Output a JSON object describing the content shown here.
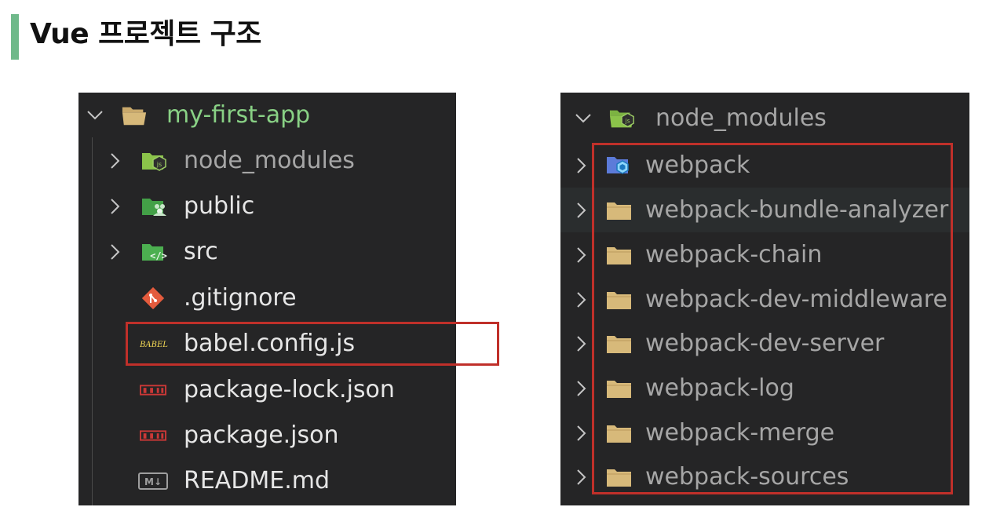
{
  "title": "Vue 프로젝트 구조",
  "colors": {
    "accent_bar": "#6fb98a",
    "panel_bg": "#252526",
    "highlight_border": "#c0302a"
  },
  "left_panel": {
    "root": {
      "label": "my-first-app",
      "icon": "folder-open-icon",
      "expanded": true
    },
    "items": [
      {
        "label": "node_modules",
        "icon": "nodejs-folder-icon",
        "type": "folder"
      },
      {
        "label": "public",
        "icon": "public-folder-icon",
        "type": "folder"
      },
      {
        "label": "src",
        "icon": "src-folder-icon",
        "type": "folder"
      },
      {
        "label": ".gitignore",
        "icon": "git-icon",
        "type": "file"
      },
      {
        "label": "babel.config.js",
        "icon": "babel-icon",
        "type": "file",
        "highlighted": true
      },
      {
        "label": "package-lock.json",
        "icon": "npm-icon",
        "type": "file"
      },
      {
        "label": "package.json",
        "icon": "npm-icon",
        "type": "file"
      },
      {
        "label": "README.md",
        "icon": "markdown-icon",
        "type": "file"
      }
    ]
  },
  "right_panel": {
    "root": {
      "label": "node_modules",
      "icon": "nodejs-folder-icon",
      "expanded": true
    },
    "items": [
      {
        "label": "webpack",
        "icon": "webpack-icon"
      },
      {
        "label": "webpack-bundle-analyzer",
        "icon": "folder-icon"
      },
      {
        "label": "webpack-chain",
        "icon": "folder-icon"
      },
      {
        "label": "webpack-dev-middleware",
        "icon": "folder-icon"
      },
      {
        "label": "webpack-dev-server",
        "icon": "folder-icon"
      },
      {
        "label": "webpack-log",
        "icon": "folder-icon"
      },
      {
        "label": "webpack-merge",
        "icon": "folder-icon"
      },
      {
        "label": "webpack-sources",
        "icon": "folder-icon"
      }
    ]
  }
}
